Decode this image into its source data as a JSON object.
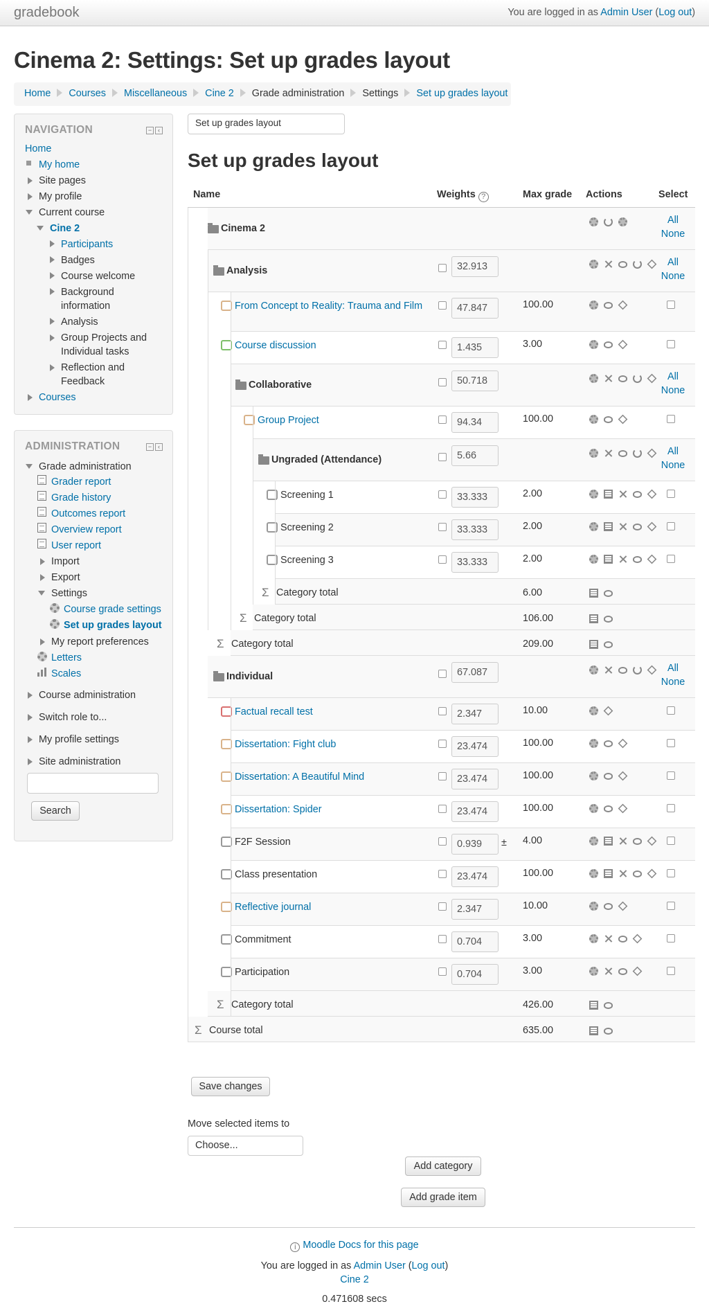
{
  "header": {
    "brand": "gradebook",
    "login_prefix": "You are logged in as ",
    "user": "Admin User",
    "logout": "Log out"
  },
  "page_title": "Cinema 2: Settings: Set up grades layout",
  "breadcrumb": [
    "Home",
    "Courses",
    "Miscellaneous",
    "Cine 2",
    "Grade administration",
    "Settings",
    "Set up grades layout"
  ],
  "navigation": {
    "title": "NAVIGATION",
    "items": [
      "Home",
      "My home",
      "Site pages",
      "My profile",
      "Current course",
      "Cine 2",
      "Participants",
      "Badges",
      "Course welcome",
      "Background information",
      "Analysis",
      "Group Projects and Individual tasks",
      "Reflection and Feedback",
      "Courses"
    ]
  },
  "administration": {
    "title": "ADMINISTRATION",
    "items": [
      "Grade administration",
      "Grader report",
      "Grade history",
      "Outcomes report",
      "Overview report",
      "User report",
      "Import",
      "Export",
      "Settings",
      "Course grade settings",
      "Set up grades layout",
      "My report preferences",
      "Letters",
      "Scales",
      "Course administration",
      "Switch role to...",
      "My profile settings",
      "Site administration"
    ],
    "search_button": "Search"
  },
  "report_select": "Set up grades layout",
  "section_title": "Set up grades layout",
  "table": {
    "headers": {
      "name": "Name",
      "weights": "Weights",
      "max_grade": "Max grade",
      "actions": "Actions",
      "select": "Select"
    },
    "select_all": "All",
    "select_none": "None",
    "rows": [
      {
        "name": "Cinema 2",
        "weight": "",
        "max": ""
      },
      {
        "name": "Analysis",
        "weight": "32.913",
        "max": ""
      },
      {
        "name": "From Concept to Reality: Trauma and Film",
        "weight": "47.847",
        "max": "100.00"
      },
      {
        "name": "Course discussion",
        "weight": "1.435",
        "max": "3.00"
      },
      {
        "name": "Collaborative",
        "weight": "50.718",
        "max": ""
      },
      {
        "name": "Group Project",
        "weight": "94.34",
        "max": "100.00"
      },
      {
        "name": "Ungraded (Attendance)",
        "weight": "5.66",
        "max": ""
      },
      {
        "name": "Screening 1",
        "weight": "33.333",
        "max": "2.00"
      },
      {
        "name": "Screening 2",
        "weight": "33.333",
        "max": "2.00"
      },
      {
        "name": "Screening 3",
        "weight": "33.333",
        "max": "2.00"
      },
      {
        "name": "Category total",
        "weight": "",
        "max": "6.00"
      },
      {
        "name": "Category total",
        "weight": "",
        "max": "106.00"
      },
      {
        "name": "Category total",
        "weight": "",
        "max": "209.00"
      },
      {
        "name": "Individual",
        "weight": "67.087",
        "max": ""
      },
      {
        "name": "Factual recall test",
        "weight": "2.347",
        "max": "10.00"
      },
      {
        "name": "Dissertation: Fight club",
        "weight": "23.474",
        "max": "100.00"
      },
      {
        "name": "Dissertation: A Beautiful Mind",
        "weight": "23.474",
        "max": "100.00"
      },
      {
        "name": "Dissertation: Spider",
        "weight": "23.474",
        "max": "100.00"
      },
      {
        "name": "F2F Session",
        "weight": "0.939",
        "max": "4.00",
        "override": "±"
      },
      {
        "name": "Class presentation",
        "weight": "23.474",
        "max": "100.00"
      },
      {
        "name": "Reflective journal",
        "weight": "2.347",
        "max": "10.00"
      },
      {
        "name": "Commitment",
        "weight": "0.704",
        "max": "3.00"
      },
      {
        "name": "Participation",
        "weight": "0.704",
        "max": "3.00"
      },
      {
        "name": "Category total",
        "weight": "",
        "max": "426.00"
      },
      {
        "name": "Course total",
        "weight": "",
        "max": "635.00"
      }
    ]
  },
  "buttons": {
    "save": "Save changes",
    "move_label": "Move selected items to",
    "move_select": "Choose...",
    "add_category": "Add category",
    "add_grade_item": "Add grade item"
  },
  "footer": {
    "docs": "Moodle Docs for this page",
    "login_prefix": "You are logged in as ",
    "user": "Admin User",
    "logout": "Log out",
    "course": "Cine 2",
    "timing": "0.471608 secs"
  },
  "colors": {
    "link": "#0070a8",
    "row_alt": "#f9f9f9",
    "block_bg": "#f5f5f5"
  }
}
